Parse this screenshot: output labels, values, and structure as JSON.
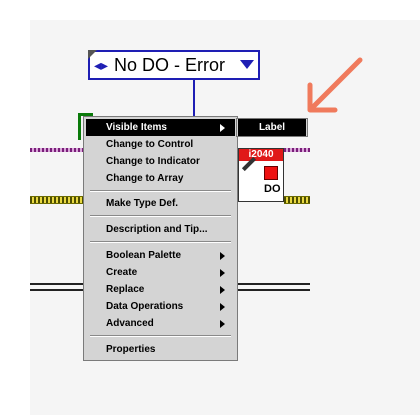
{
  "ring": {
    "label": "No DO - Error"
  },
  "node": {
    "header": "i2040",
    "label": "DO"
  },
  "menu": {
    "items": [
      {
        "label": "Visible Items",
        "submenu": true,
        "highlighted": true
      },
      {
        "label": "Change to Control"
      },
      {
        "label": "Change to Indicator"
      },
      {
        "label": "Change to Array"
      },
      {
        "label": "Make Type Def."
      },
      {
        "label": "Description and Tip..."
      },
      {
        "label": "Boolean Palette",
        "submenu": true
      },
      {
        "label": "Create",
        "submenu": true
      },
      {
        "label": "Replace",
        "submenu": true
      },
      {
        "label": "Data Operations",
        "submenu": true
      },
      {
        "label": "Advanced",
        "submenu": true
      },
      {
        "label": "Properties"
      }
    ]
  },
  "submenu": {
    "items": [
      {
        "label": "Label",
        "highlighted": true
      }
    ]
  },
  "colors": {
    "wire_blue": "#1e1eb4",
    "error_red": "#e01818",
    "pointer": "#f07a5c",
    "menu_bg": "#d4d4d4"
  },
  "icons": {
    "pointer": "pointer-arrow-icon",
    "ring_left": "inc-dec-icon",
    "ring_down": "dropdown-arrow-icon"
  }
}
